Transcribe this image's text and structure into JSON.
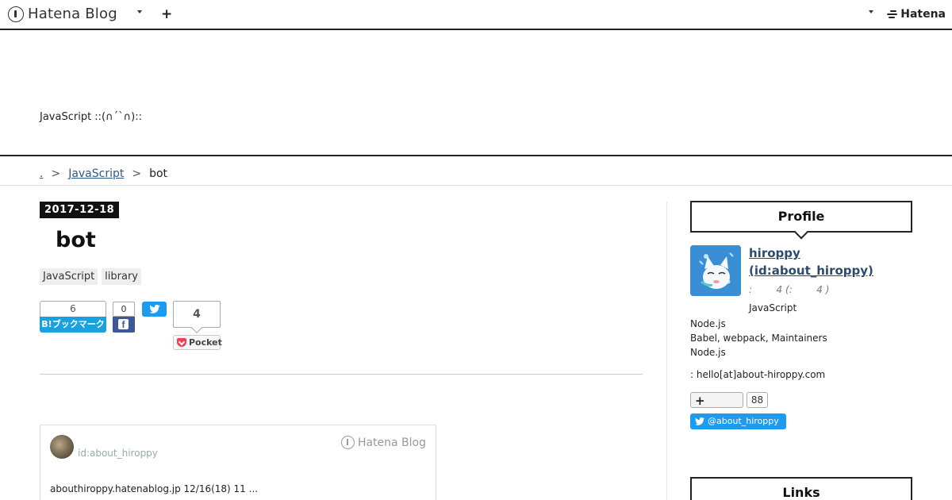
{
  "globalheader": {
    "logo_text": "Hatena Blog",
    "add_label": "+",
    "hatena_label": "Hatena"
  },
  "blog": {
    "description": "JavaScript ::(∩´`∩)::"
  },
  "breadcrumb": {
    "home": ".",
    "category": "JavaScript",
    "current": "bot",
    "separator": ">"
  },
  "entry": {
    "date": "2017-12-18",
    "title": "bot",
    "categories": [
      "JavaScript",
      "library"
    ]
  },
  "share": {
    "hatena_count": "6",
    "hatena_label": "B!ブックマーク",
    "facebook_count": "0",
    "facebook_label": "f",
    "pocket_count": "4",
    "pocket_label": "Pocket"
  },
  "embed": {
    "user": "id:about_hiroppy",
    "brand": "Hatena Blog",
    "text": "abouthiroppy.hatenablog.jp 12/16(18) 11 ..."
  },
  "sidebar": {
    "profile_title": "Profile",
    "name_line1": "hiroppy",
    "name_line2": "(id:about_hiroppy)",
    "meta": ":        4 (:        4 )",
    "desc_line1": "JavaScript",
    "desc_lines": [
      "Node.js",
      "Babel, webpack, Maintainers",
      "Node.js"
    ],
    "mail": ": hello[at]about-hiroppy.com",
    "follow_icon": "+",
    "follow_count": "88",
    "twitter_handle": "@about_hiroppy",
    "links_title": "Links"
  }
}
